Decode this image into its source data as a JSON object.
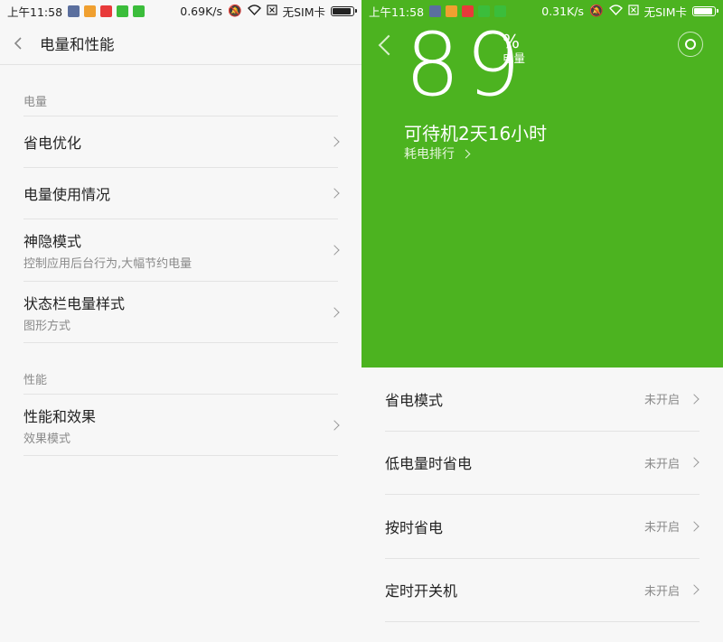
{
  "left": {
    "status": {
      "time": "上午11:58",
      "speed": "0.69K/s",
      "sim": "无SIM卡"
    },
    "title": "电量和性能",
    "sections": [
      {
        "header": "电量",
        "items": [
          {
            "label": "省电优化"
          },
          {
            "label": "电量使用情况"
          },
          {
            "label": "神隐模式",
            "sub": "控制应用后台行为,大幅节约电量"
          },
          {
            "label": "状态栏电量样式",
            "sub": "图形方式"
          }
        ]
      },
      {
        "header": "性能",
        "items": [
          {
            "label": "性能和效果",
            "sub": "效果模式"
          }
        ]
      }
    ]
  },
  "right": {
    "status": {
      "time": "上午11:58",
      "speed": "0.31K/s",
      "sim": "无SIM卡"
    },
    "battery_percent": "89",
    "percent_sign": "%",
    "percent_label": "电量",
    "standby": "可待机2天16小时",
    "ranking_link": "耗电排行",
    "items": [
      {
        "label": "省电模式",
        "state": "未开启"
      },
      {
        "label": "低电量时省电",
        "state": "未开启"
      },
      {
        "label": "按时省电",
        "state": "未开启"
      },
      {
        "label": "定时开关机",
        "state": "未开启"
      }
    ]
  },
  "colors": {
    "accent_green": "#4cb320",
    "background": "#f7f7f7"
  }
}
